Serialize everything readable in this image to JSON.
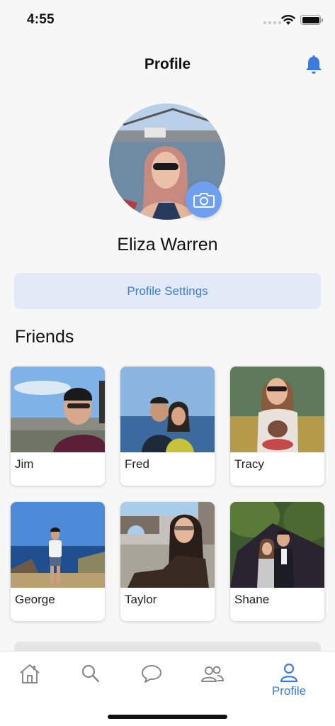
{
  "status_bar": {
    "time": "4:55"
  },
  "header": {
    "title": "Profile",
    "bell_icon": "bell-icon"
  },
  "profile": {
    "name": "Eliza Warren",
    "camera_icon": "camera-icon",
    "settings_label": "Profile Settings"
  },
  "friends": {
    "title": "Friends",
    "items": [
      {
        "name": "Jim"
      },
      {
        "name": "Fred"
      },
      {
        "name": "Tracy"
      },
      {
        "name": "George"
      },
      {
        "name": "Taylor"
      },
      {
        "name": "Shane"
      }
    ]
  },
  "tab_bar": {
    "tabs": [
      {
        "icon": "home-icon",
        "label": ""
      },
      {
        "icon": "search-icon",
        "label": ""
      },
      {
        "icon": "chat-icon",
        "label": ""
      },
      {
        "icon": "friends-icon",
        "label": ""
      },
      {
        "icon": "profile-icon",
        "label": "Profile",
        "active": true
      }
    ]
  },
  "colors": {
    "accent": "#3a7be0",
    "settings_bg": "#e3eaf7",
    "camera_bg": "#6e9ff0"
  }
}
